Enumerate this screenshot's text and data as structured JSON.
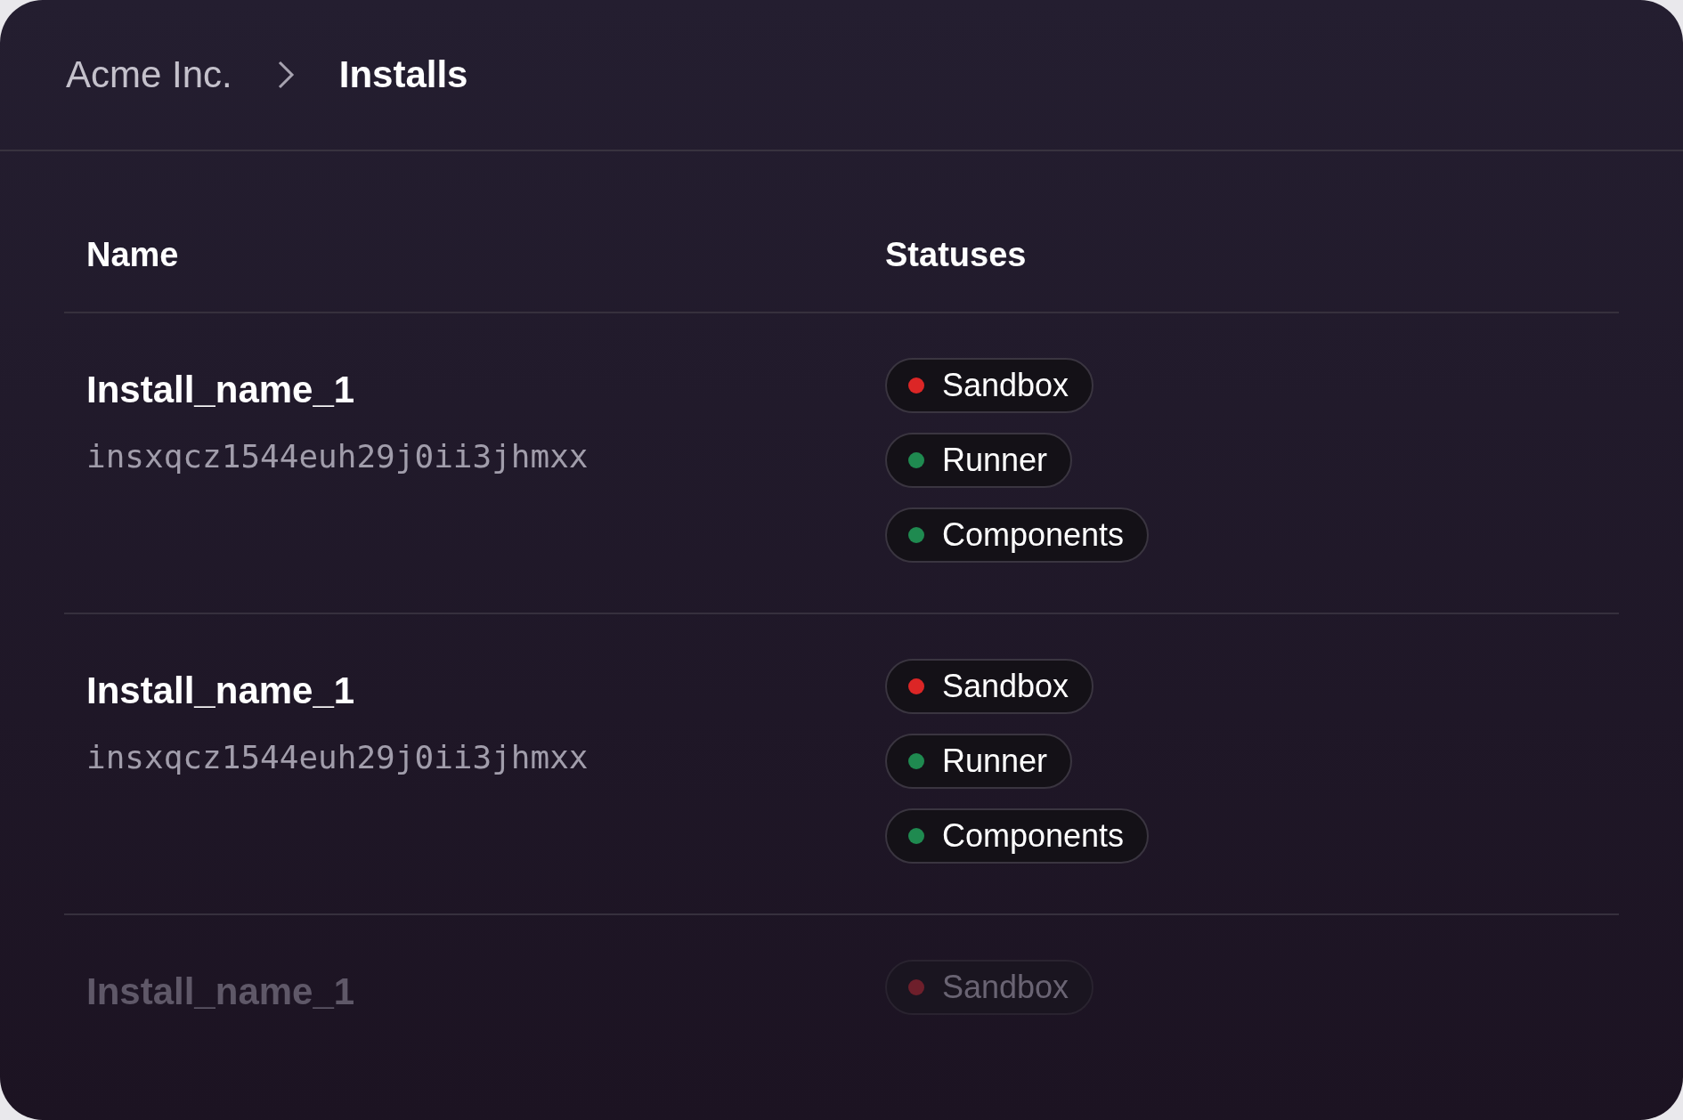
{
  "breadcrumb": [
    {
      "label": "Acme Inc.",
      "current": false
    },
    {
      "label": "Installs",
      "current": true
    }
  ],
  "table": {
    "columns": [
      "Name",
      "Statuses"
    ],
    "rows": [
      {
        "name": "Install_name_1",
        "id": "insxqcz1544euh29j0ii3jhmxx",
        "statuses": [
          {
            "label": "Sandbox",
            "color": "#dc2626"
          },
          {
            "label": "Runner",
            "color": "#1f8a50"
          },
          {
            "label": "Components",
            "color": "#1f8a50"
          }
        ]
      },
      {
        "name": "Install_name_1",
        "id": "insxqcz1544euh29j0ii3jhmxx",
        "statuses": [
          {
            "label": "Sandbox",
            "color": "#dc2626"
          },
          {
            "label": "Runner",
            "color": "#1f8a50"
          },
          {
            "label": "Components",
            "color": "#1f8a50"
          }
        ]
      },
      {
        "name": "Install_name_1",
        "statuses": [
          {
            "label": "Sandbox",
            "color": "#6e1f2b"
          }
        ]
      }
    ]
  }
}
